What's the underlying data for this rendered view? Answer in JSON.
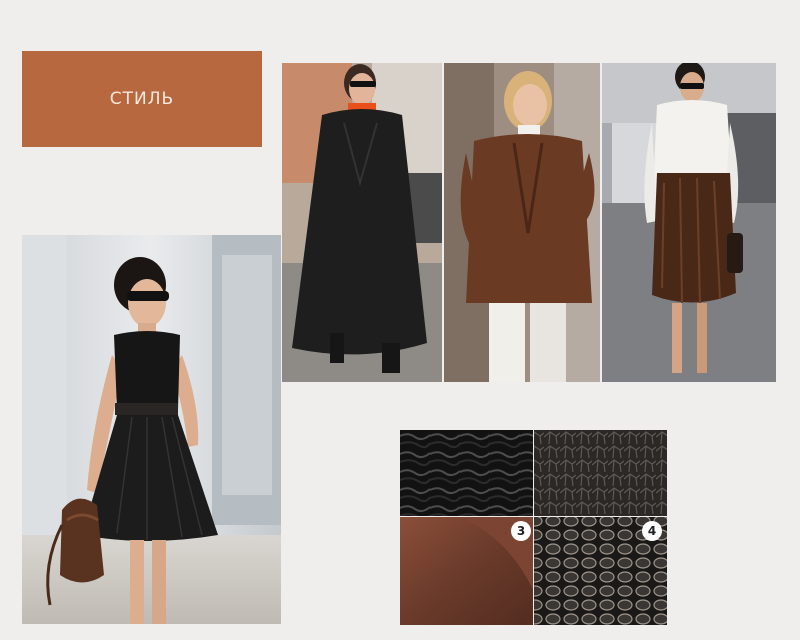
{
  "header": {
    "title": "СТИЛЬ"
  },
  "colors": {
    "accent": "#b8683f",
    "background": "#efeeec"
  },
  "images": {
    "left": "woman-black-leather-dress-photo",
    "trio": [
      "black-coat-outfit-photo",
      "brown-leather-blazer-outfit-photo",
      "snakeskin-skirt-outfit-photo"
    ],
    "textures": [
      "black-crinkled-leather",
      "dark-cracked-leather",
      "brown-suede-leather",
      "metallic-snake-leather"
    ]
  },
  "texture_badges": [
    "3",
    "4"
  ]
}
